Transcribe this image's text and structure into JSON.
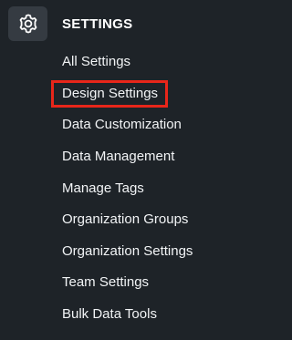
{
  "section": {
    "title": "SETTINGS",
    "icon": "gear-icon"
  },
  "menu": {
    "items": [
      {
        "label": "All Settings"
      },
      {
        "label": "Design Settings",
        "highlighted": true
      },
      {
        "label": "Data Customization"
      },
      {
        "label": "Data Management"
      },
      {
        "label": "Manage Tags"
      },
      {
        "label": "Organization Groups"
      },
      {
        "label": "Organization Settings"
      },
      {
        "label": "Team Settings"
      },
      {
        "label": "Bulk Data Tools"
      }
    ]
  },
  "colors": {
    "background": "#1e2328",
    "icon_tile": "#353b42",
    "text": "#f2f4f6",
    "highlight_border": "#e8261a"
  }
}
